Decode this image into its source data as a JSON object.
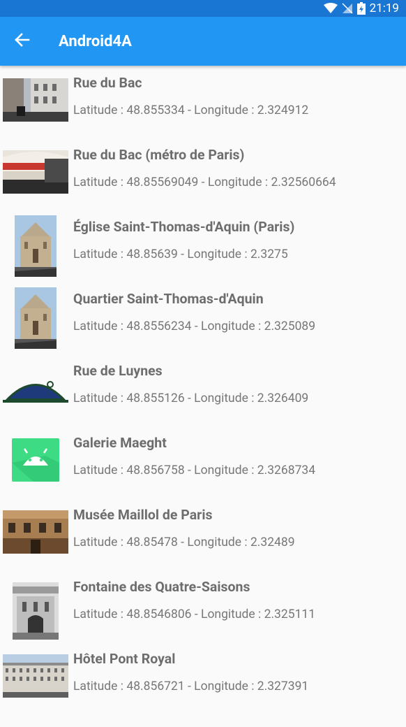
{
  "status": {
    "time": "21:19",
    "icons": [
      "wifi-icon",
      "no-sim-icon",
      "battery-icon"
    ]
  },
  "appbar": {
    "title": "Android4A",
    "back_icon": "arrow-back-icon"
  },
  "colors": {
    "statusbar": "#1976d2",
    "appbar": "#2196f3",
    "background": "#fafafa"
  },
  "items": [
    {
      "name": "Rue du Bac",
      "coords": "Latitude : 48.855334 - Longitude : 2.324912",
      "thumb": "street-photo"
    },
    {
      "name": "Rue du Bac (métro de Paris)",
      "coords": "Latitude : 48.85569049 - Longitude : 2.32560664",
      "thumb": "metro-station-photo"
    },
    {
      "name": "Église Saint-Thomas-d'Aquin (Paris)",
      "coords": "Latitude : 48.85639 - Longitude : 2.3275",
      "thumb": "church-photo"
    },
    {
      "name": "Quartier Saint-Thomas-d'Aquin",
      "coords": "Latitude : 48.8556234 - Longitude : 2.325089",
      "thumb": "church-photo"
    },
    {
      "name": "Rue de Luynes",
      "coords": "Latitude : 48.855126 - Longitude : 2.326409",
      "thumb": "street-sign-image"
    },
    {
      "name": "Galerie Maeght",
      "coords": "Latitude : 48.856758 - Longitude : 2.3268734",
      "thumb": "android-icon"
    },
    {
      "name": "Musée Maillol de Paris",
      "coords": "Latitude : 48.85478 - Longitude : 2.32489",
      "thumb": "museum-photo"
    },
    {
      "name": "Fontaine des Quatre-Saisons",
      "coords": "Latitude : 48.8546806 - Longitude : 2.325111",
      "thumb": "fountain-photo"
    },
    {
      "name": "Hôtel Pont Royal",
      "coords": "Latitude : 48.856721 - Longitude : 2.327391",
      "thumb": "hotel-photo"
    }
  ]
}
